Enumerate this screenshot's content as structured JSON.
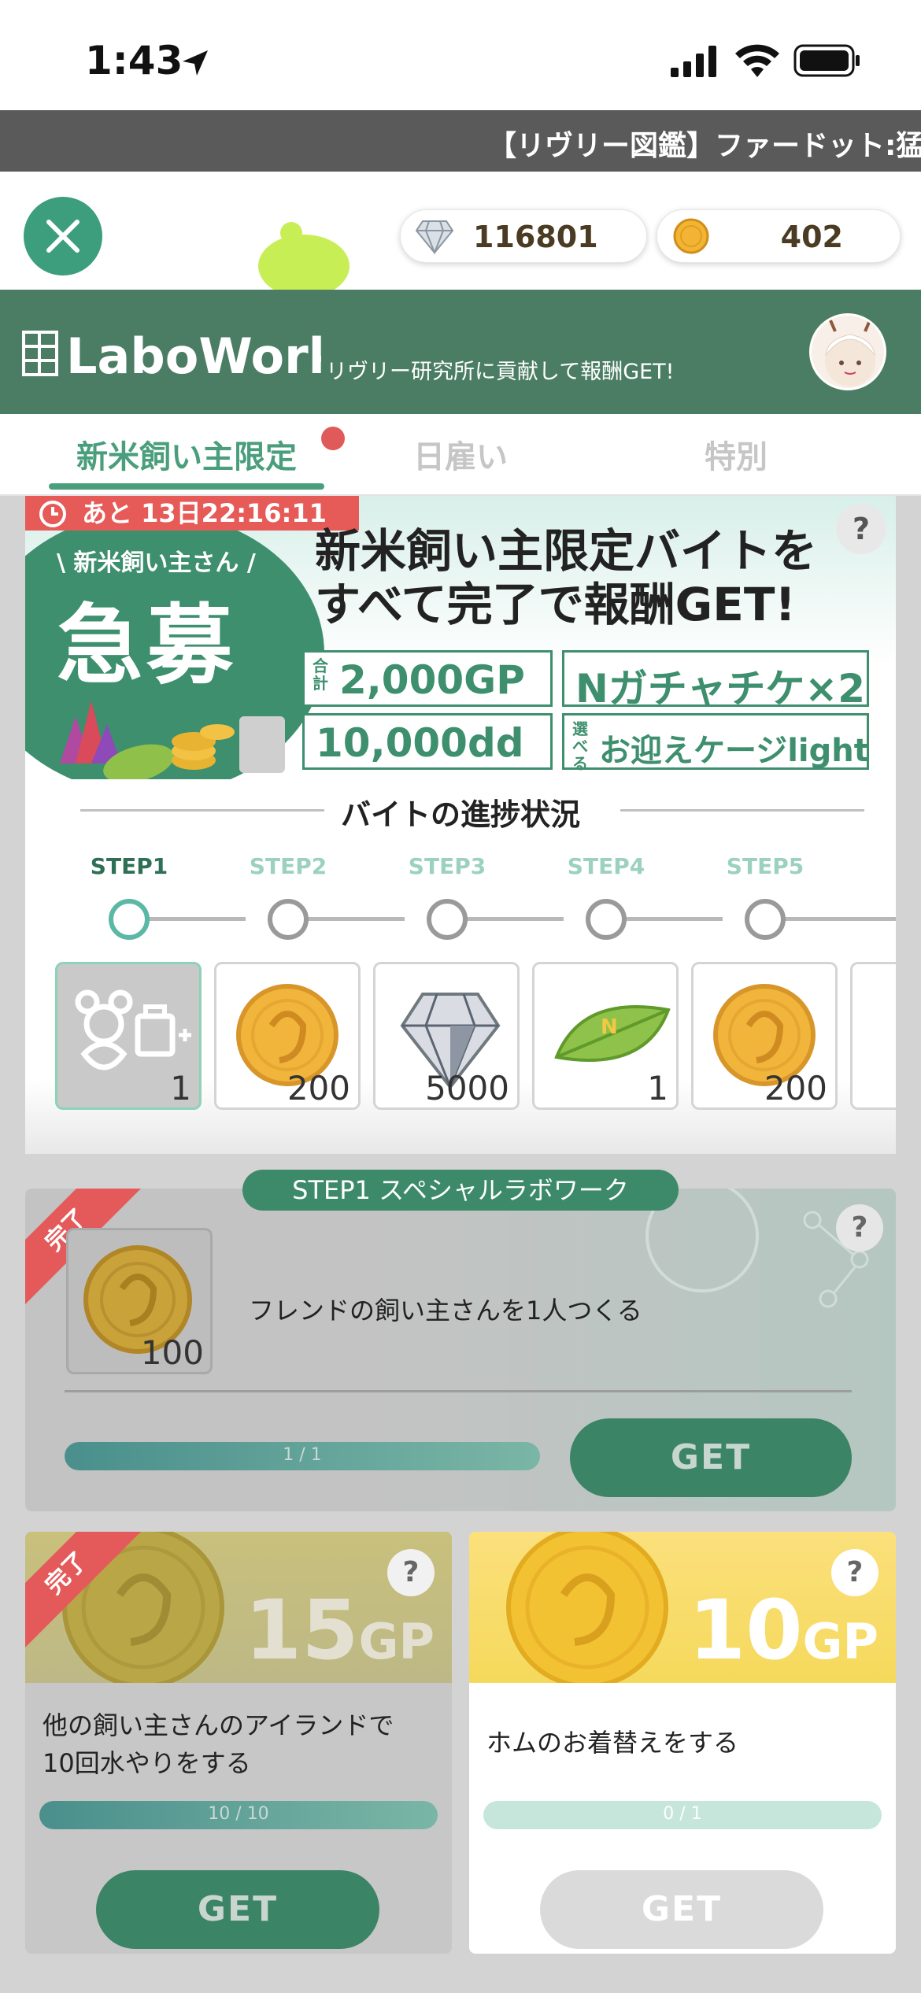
{
  "status_bar": {
    "time": "1:43"
  },
  "ticker": {
    "text": "【リヴリー図鑑】ファードット:猛"
  },
  "currency": {
    "gems": "116801",
    "coins": "402"
  },
  "header": {
    "logo_text": "LaboWork",
    "subtitle": "リヴリー研究所に貢献して報酬GET!"
  },
  "tabs": [
    {
      "label": "新米飼い主限定",
      "active": true,
      "has_badge": true
    },
    {
      "label": "日雇い",
      "active": false
    },
    {
      "label": "特別",
      "active": false
    }
  ],
  "banner": {
    "timer": "あと 13日22:16:11",
    "tag_top": "\\ 新米飼い主さん /",
    "tag_main": "急募",
    "headline_line1": "新米飼い主限定バイトを",
    "headline_line2": "すべて完了で報酬GET!",
    "rewards": [
      {
        "prefix": "合計",
        "text": "2,000GP"
      },
      {
        "prefix": "",
        "text": "Nガチャチケ×2"
      },
      {
        "prefix": "",
        "text": "10,000dd"
      },
      {
        "prefix": "選べる",
        "text": "お迎えケージlight"
      }
    ],
    "help": "?"
  },
  "progress": {
    "title": "バイトの進捗状況",
    "steps": [
      "STEP1",
      "STEP2",
      "STEP3",
      "STEP4",
      "STEP5"
    ],
    "reward_items": [
      {
        "icon": "cage-icon",
        "qty": "1"
      },
      {
        "icon": "coin-icon",
        "qty": "200"
      },
      {
        "icon": "diamond-icon",
        "qty": "5000"
      },
      {
        "icon": "leaf-icon",
        "qty": "1"
      },
      {
        "icon": "coin-icon",
        "qty": "200"
      }
    ]
  },
  "special": {
    "tag": "STEP1 スペシャルラボワーク",
    "done_label": "完了",
    "reward_qty": "100",
    "task": "フレンドの飼い主さんを1人つくる",
    "progress_text": "1 / 1",
    "progress": 1.0,
    "button": "GET",
    "help": "?"
  },
  "missions": [
    {
      "done_label": "完了",
      "gp_value": "15",
      "gp_unit": "GP",
      "task_line1": "他の飼い主さんのアイランドで",
      "task_line2": "10回水やりをする",
      "progress_text": "10 / 10",
      "progress": 1.0,
      "button": "GET",
      "help": "?"
    },
    {
      "gp_value": "10",
      "gp_unit": "GP",
      "task_line1": "ホムのお着替えをする",
      "progress_text": "0 / 1",
      "progress": 0.0,
      "button": "GET",
      "help": "?"
    }
  ],
  "colors": {
    "brand_green": "#4a7d63",
    "accent_green": "#3c9e7d",
    "ribbon_red": "#e45a5a",
    "gold": "#f5d95c"
  }
}
